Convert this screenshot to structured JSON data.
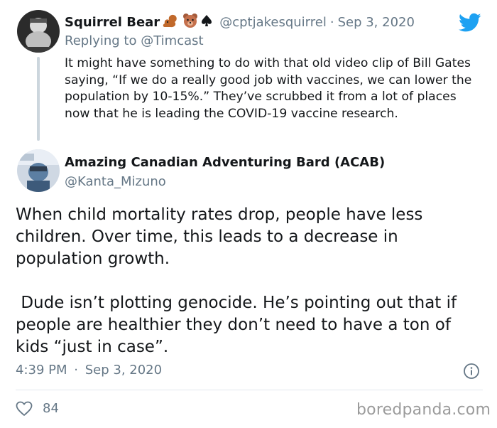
{
  "parent_tweet": {
    "display_name": "Squirrel Bear",
    "name_emojis": [
      "squirrel-emoji",
      "bear-emoji",
      "spade-emoji"
    ],
    "handle": "@cptjakesquirrel",
    "separator": "·",
    "date": "Sep 3, 2020",
    "replying_prefix": "Replying to",
    "replying_to": "@Timcast",
    "text": "It might have something to do with that old video clip of Bill Gates saying, “If we do a really good job with vaccines, we can lower the population by 10-15%.” They’ve scrubbed it from a lot of places now that he is leading the COVID-19 vaccine research."
  },
  "main_tweet": {
    "display_name": "Amazing Canadian Adventuring Bard (ACAB)",
    "handle": "@Kanta_Mizuno",
    "paragraphs": [
      "When child mortality rates drop, people have less children. Over time, this leads to a decrease in population growth.",
      " Dude isn’t plotting genocide. He’s pointing out that if people are healthier they don’t need to have a ton of kids “just in case”."
    ],
    "time": "4:39 PM",
    "separator": "·",
    "date": "Sep 3, 2020",
    "likes": "84"
  },
  "watermark": "boredpanda.com",
  "colors": {
    "text": "#14171a",
    "secondary": "#657786",
    "twitter_blue": "#1da1f2",
    "divider": "#e1e8ed",
    "thread_line": "#ccd6dd",
    "watermark": "#9b9b9b"
  }
}
